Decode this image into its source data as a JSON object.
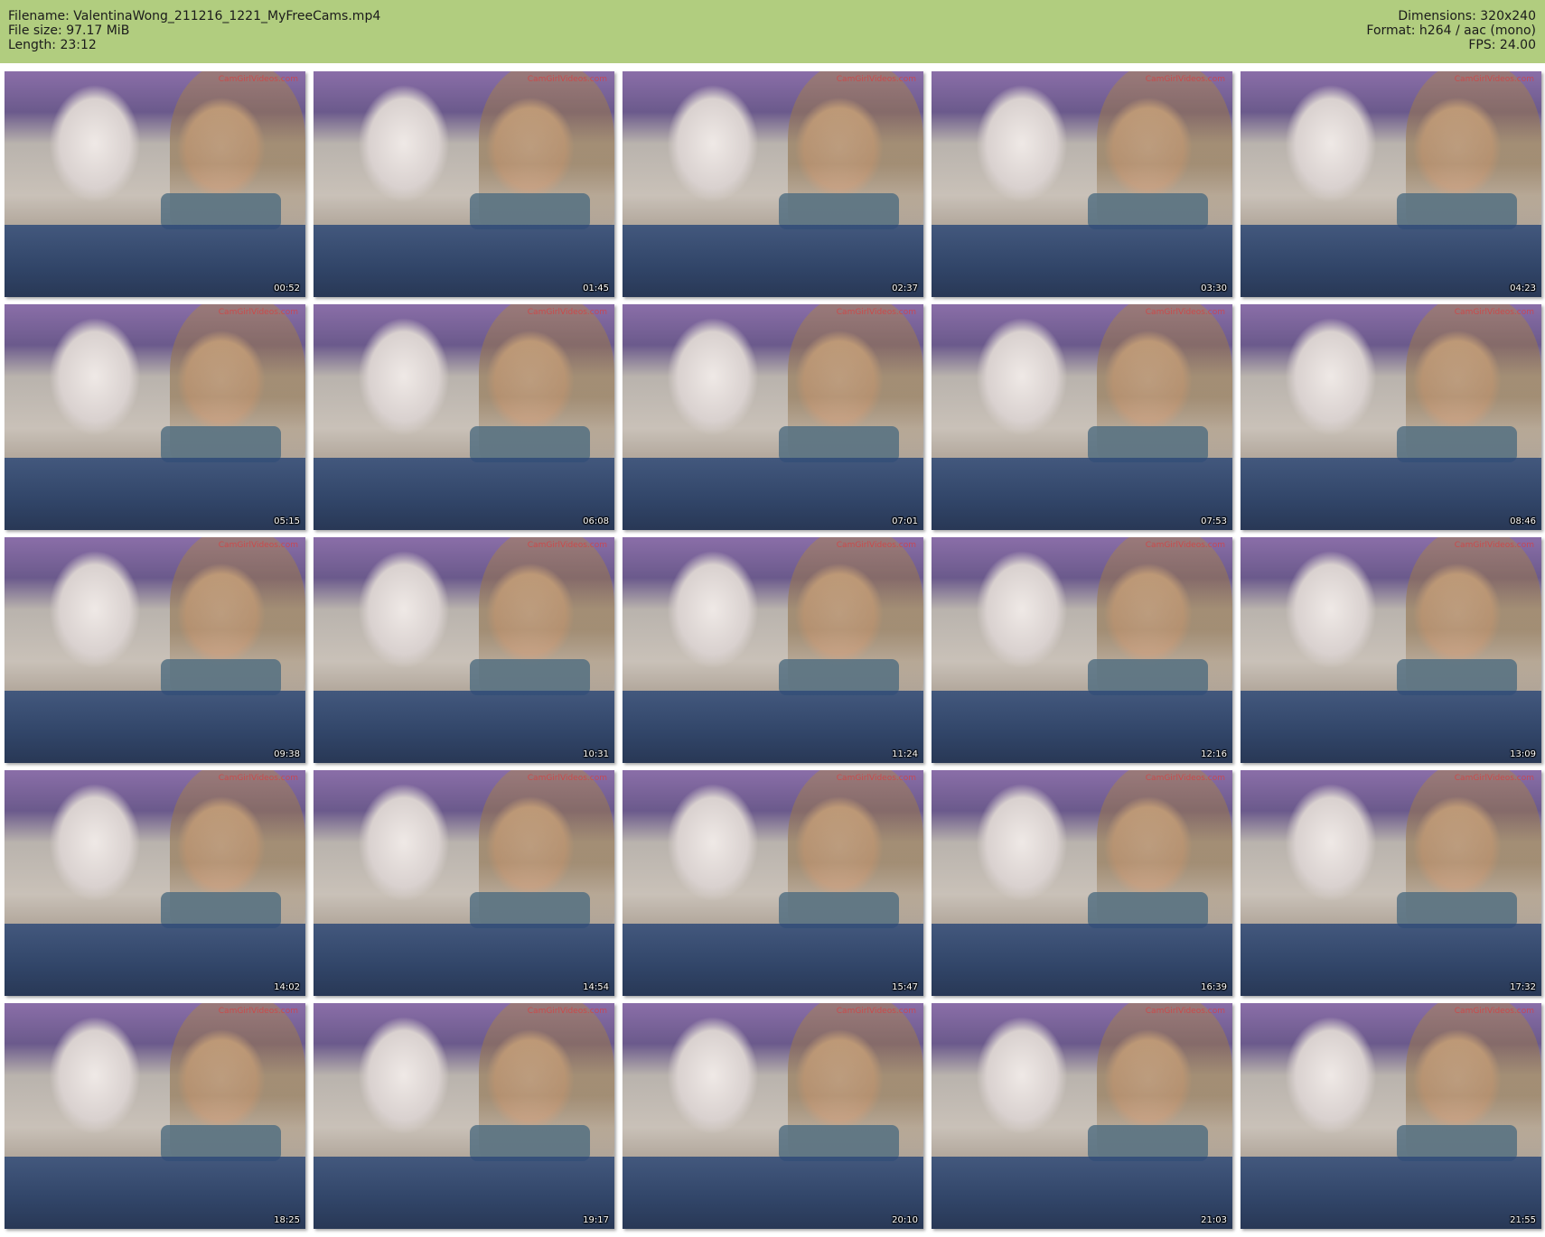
{
  "header": {
    "filename": "Filename: ValentinaWong_211216_1221_MyFreeCams.mp4",
    "file_size": "File size: 97.17 MiB",
    "length": "Length: 23:12",
    "dimensions": "Dimensions: 320x240",
    "format": "Format: h264 / aac (mono)",
    "fps": "FPS: 24.00"
  },
  "colors": {
    "header_bg": "#b1cd7f"
  },
  "thumbnails": [
    {
      "time": "00:52"
    },
    {
      "time": "01:45"
    },
    {
      "time": "02:37"
    },
    {
      "time": "03:30"
    },
    {
      "time": "04:23"
    },
    {
      "time": "05:15"
    },
    {
      "time": "06:08"
    },
    {
      "time": "07:01"
    },
    {
      "time": "07:53"
    },
    {
      "time": "08:46"
    },
    {
      "time": "09:38"
    },
    {
      "time": "10:31"
    },
    {
      "time": "11:24"
    },
    {
      "time": "12:16"
    },
    {
      "time": "13:09"
    },
    {
      "time": "14:02"
    },
    {
      "time": "14:54"
    },
    {
      "time": "15:47"
    },
    {
      "time": "16:39"
    },
    {
      "time": "17:32"
    },
    {
      "time": "18:25"
    },
    {
      "time": "19:17"
    },
    {
      "time": "20:10"
    },
    {
      "time": "21:03"
    },
    {
      "time": "21:55"
    }
  ],
  "watermark": "CamGirlVideos.com"
}
